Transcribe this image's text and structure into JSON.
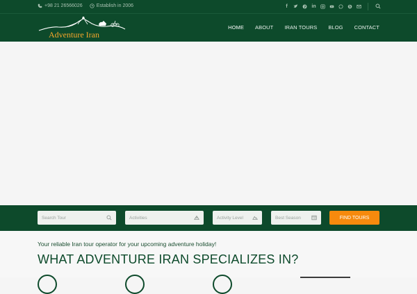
{
  "topbar": {
    "phone": "+98 21 26566026",
    "established": "Establish in 2006",
    "social_icons": [
      "facebook-icon",
      "twitter-icon",
      "pinterest-icon",
      "linkedin-icon",
      "instagram-icon",
      "youtube-icon",
      "whatsapp-icon",
      "skype-icon",
      "email-icon"
    ]
  },
  "brand": {
    "name": "Adventure Iran"
  },
  "nav": {
    "home": "HOME",
    "about": "ABOUT",
    "tours": "IRAN TOURS",
    "blog": "BLOG",
    "contact": "CONTACT"
  },
  "search": {
    "tour_placeholder": "Search Tour",
    "activities_placeholder": "Activities",
    "level_placeholder": "Activity Level",
    "season_placeholder": "Best Season",
    "button": "FIND TOURS"
  },
  "content": {
    "tagline": "Your reliable Iran tour operator for your upcoming adventure holiday!",
    "headline": "WHAT ADVENTURE IRAN SPECIALIZES IN?"
  },
  "colors": {
    "primary": "#0d4a2b",
    "accent": "#f68a0d",
    "logo": "#f7a62b"
  }
}
